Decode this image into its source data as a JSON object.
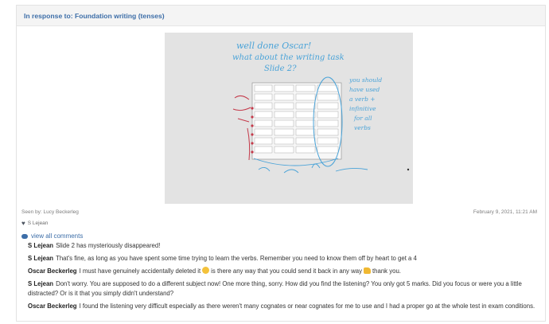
{
  "post": {
    "in_response_to": "In response to: Foundation writing (tenses)",
    "seen_by": "Seen by: Lucy Beckerleg",
    "date": "February 9, 2021, 11:21 AM",
    "likes": "S Lejean",
    "view_all_comments": "view all comments",
    "image_annotations": {
      "line1": "well done Oscar!",
      "line2": "what about the writing task",
      "line3": "Slide 2?",
      "side1": "you should",
      "side2": "have used",
      "side3": "a verb +",
      "side4": "infinitive",
      "side5": "for all",
      "side6": "verbs"
    }
  },
  "comments": [
    {
      "author": "S Lejean",
      "text": "Slide 2 has mysteriously disappeared!"
    },
    {
      "author": "S Lejean",
      "text": "That's fine, as long as you have spent some time trying to learn the verbs. Remember you need to know them off by heart to get a 4"
    },
    {
      "author": "Oscar Beckerleg",
      "text_before": "I must have genuinely accidentally deleted it",
      "text_middle": "is there any way that you could send it back in any way",
      "text_after": "thank you."
    },
    {
      "author": "S Lejean",
      "text": "Don't worry. You are supposed to do a different subject now! One more thing, sorry. How did you find the listening? You only got 5 marks. Did you focus or were you a little distracted? Or is it that you simply didn't understand?"
    },
    {
      "author": "Oscar Beckerleg",
      "text": "I found the listening very difficult especially as there weren't many cognates or near cognates for me to use and I had a proper go at the whole test in exam conditions."
    }
  ],
  "colors": {
    "link": "#3d6ea8",
    "ink_blue": "#4aa3d8",
    "ink_red": "#c43a4a"
  }
}
